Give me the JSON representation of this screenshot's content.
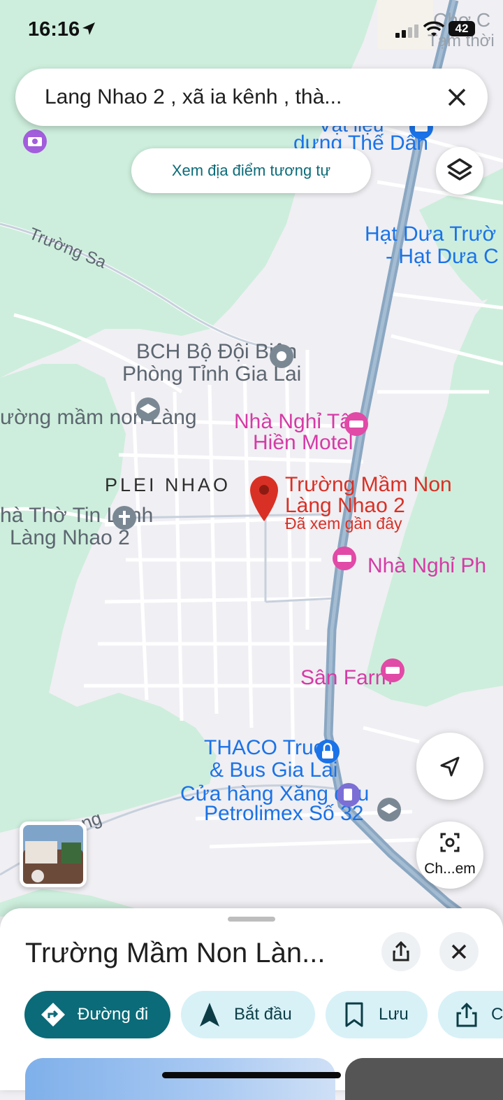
{
  "status_bar": {
    "time": "16:16",
    "battery": "42"
  },
  "search": {
    "query": "Lang Nhao 2 , xã ia kênh , thà..."
  },
  "actions": {
    "similar_places": "Xem địa điểm tương tự",
    "lens_label": "Ch...em"
  },
  "map": {
    "labels": {
      "cho_1": "Chợ C",
      "cho_2": "Tạm thời",
      "vatlieu_1": "Vật liệu",
      "vatlieu_2": "dựng Thế Dân",
      "truong_sa": "Trường Sa",
      "hatdua_1": "Hạt Dưa Trườ",
      "hatdua_2": "- Hạt Dưa C",
      "bch_1": "BCH Bộ Đội Biên",
      "bch_2": "Phòng Tỉnh Gia Lai",
      "mamnon_left": "ường mầm non Làng",
      "nhanghi_1": "Nhà Nghỉ Tâm",
      "nhanghi_2": "Hiền Motel",
      "plei_nhao": "PLEI NHAO",
      "pin_1": "Trường Mầm Non",
      "pin_2": "Làng Nhao 2",
      "pin_3": "Đã xem gần đây",
      "nhatho_1": "hà Thờ Tin Lành",
      "nhatho_2": "Làng Nhao 2",
      "nhanghi_ph": "Nhà Nghỉ Ph",
      "san_farm": "Sân Farm",
      "thaco_1": "THACO Truck",
      "thaco_2": "& Bus Gia Lai",
      "xang_1": "Cửa hàng Xăng dầu",
      "xang_2": "Petrolimex Số 32",
      "road_ng": "ng"
    },
    "colors": {
      "green": "#cdeedc",
      "land": "#f0eff3",
      "highway": "#8aa7c2",
      "blue_label": "#1a73e8",
      "pink_label": "#d63aa6",
      "pin": "#d93025"
    }
  },
  "sheet": {
    "title": "Trường Mầm Non Làn...",
    "chips": {
      "directions": "Đường đi",
      "start": "Bắt đầu",
      "save": "Lưu",
      "share": "C"
    }
  }
}
